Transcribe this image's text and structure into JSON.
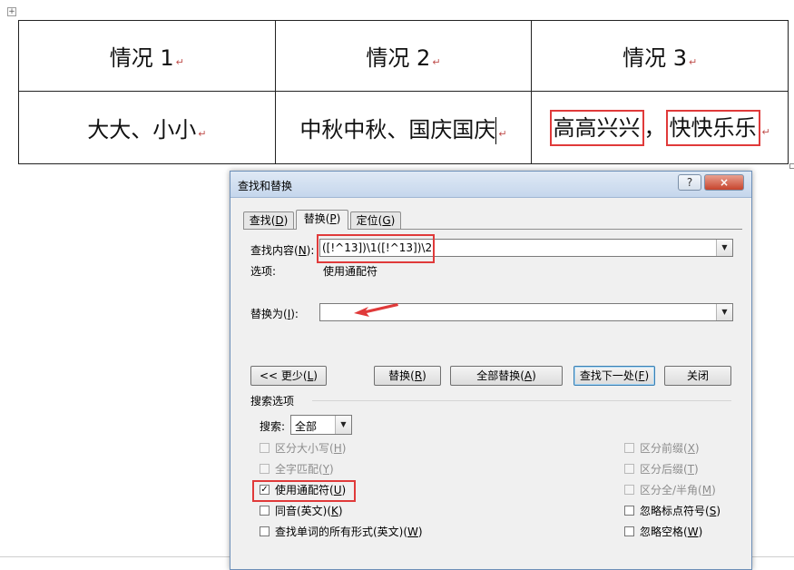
{
  "table": {
    "headers": [
      "情况 1",
      "情况 2",
      "情况 3"
    ],
    "row": {
      "c1": "大大、小小",
      "c2": "中秋中秋、国庆国庆",
      "c3_part1": "高高兴兴",
      "c3_sep": "，",
      "c3_part2": "快快乐乐"
    },
    "paragraph_mark": "↵",
    "move_handle": "+"
  },
  "dialog": {
    "title": "查找和替换",
    "help": "?",
    "close": "×",
    "tabs": [
      {
        "label": "查找(",
        "key": "D",
        "end": ")"
      },
      {
        "label": "替换(",
        "key": "P",
        "end": ")"
      },
      {
        "label": "定位(",
        "key": "G",
        "end": ")"
      }
    ],
    "find": {
      "label_pre": "查找内容(",
      "key": "N",
      "label_post": "):",
      "value": "([!^13])\\1([!^13])\\2"
    },
    "options": {
      "label": "选项:",
      "value": "使用通配符"
    },
    "replace": {
      "label_pre": "替换为(",
      "key": "I",
      "label_post": "):",
      "value": ""
    },
    "buttons": {
      "less": {
        "pre": "<< 更少(",
        "key": "L",
        "post": ")"
      },
      "replace": {
        "pre": "替换(",
        "key": "R",
        "post": ")"
      },
      "replace_all": {
        "pre": "全部替换(",
        "key": "A",
        "post": ")"
      },
      "find_next": {
        "pre": "查找下一处(",
        "key": "F",
        "post": ")"
      },
      "close": "关闭"
    },
    "search_options_title": "搜索选项",
    "search": {
      "label": "搜索:",
      "value": "全部"
    },
    "checks_left": [
      {
        "pre": "区分大小写(",
        "key": "H",
        "post": ")",
        "checked": false,
        "enabled": false
      },
      {
        "pre": "全字匹配(",
        "key": "Y",
        "post": ")",
        "checked": false,
        "enabled": false
      },
      {
        "pre": "使用通配符(",
        "key": "U",
        "post": ")",
        "checked": true,
        "enabled": true
      },
      {
        "pre": "同音(英文)(",
        "key": "K",
        "post": ")",
        "checked": false,
        "enabled": true
      },
      {
        "pre": "查找单词的所有形式(英文)(",
        "key": "W",
        "post": ")",
        "checked": false,
        "enabled": true
      }
    ],
    "checks_right": [
      {
        "pre": "区分前缀(",
        "key": "X",
        "post": ")",
        "checked": false,
        "enabled": false
      },
      {
        "pre": "区分后缀(",
        "key": "T",
        "post": ")",
        "checked": false,
        "enabled": false
      },
      {
        "pre": "区分全/半角(",
        "key": "M",
        "post": ")",
        "checked": false,
        "enabled": false
      },
      {
        "pre": "忽略标点符号(",
        "key": "S",
        "post": ")",
        "checked": false,
        "enabled": true
      },
      {
        "pre": "忽略空格(",
        "key": "W",
        "post": ")",
        "checked": false,
        "enabled": true
      }
    ],
    "check_mark": "✓",
    "dropdown_icon": "▼",
    "annotation_color": "#e03a3a"
  }
}
